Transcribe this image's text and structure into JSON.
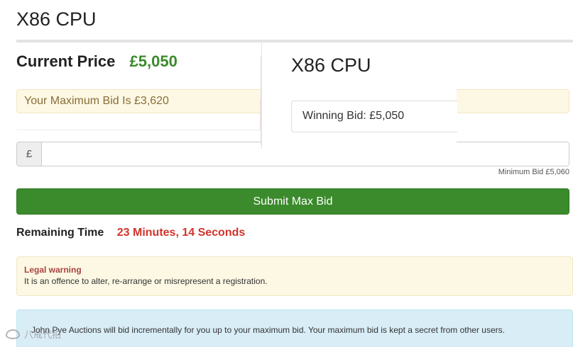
{
  "page": {
    "title": "X86 CPU"
  },
  "pricing": {
    "current_price_label": "Current Price",
    "current_price_value": "£5,050",
    "max_bid_notice": "Your Maximum Bid Is £3,620"
  },
  "bid_form": {
    "currency_symbol": "£",
    "input_value": "",
    "minimum_bid": "Minimum Bid £5,060",
    "submit_label": "Submit Max Bid"
  },
  "timer": {
    "label": "Remaining Time",
    "value": "23 Minutes, 14 Seconds"
  },
  "legal": {
    "title": "Legal warning",
    "text": "It is an offence to alter, re-arrange or misrepresent a registration."
  },
  "info": {
    "text": "John Pye Auctions will bid incrementally for you up to your maximum bid. Your maximum bid is kept a secret from other users."
  },
  "winning_panel": {
    "title": "X86 CPU",
    "winning_bid": "Winning Bid: £5,050"
  },
  "watermark": {
    "text": "八戒代拍"
  },
  "colors": {
    "accent_green": "#3b8a2c",
    "timer_red": "#d0342c",
    "warning_bg": "#fcf8e3",
    "info_bg": "#d9edf7"
  }
}
